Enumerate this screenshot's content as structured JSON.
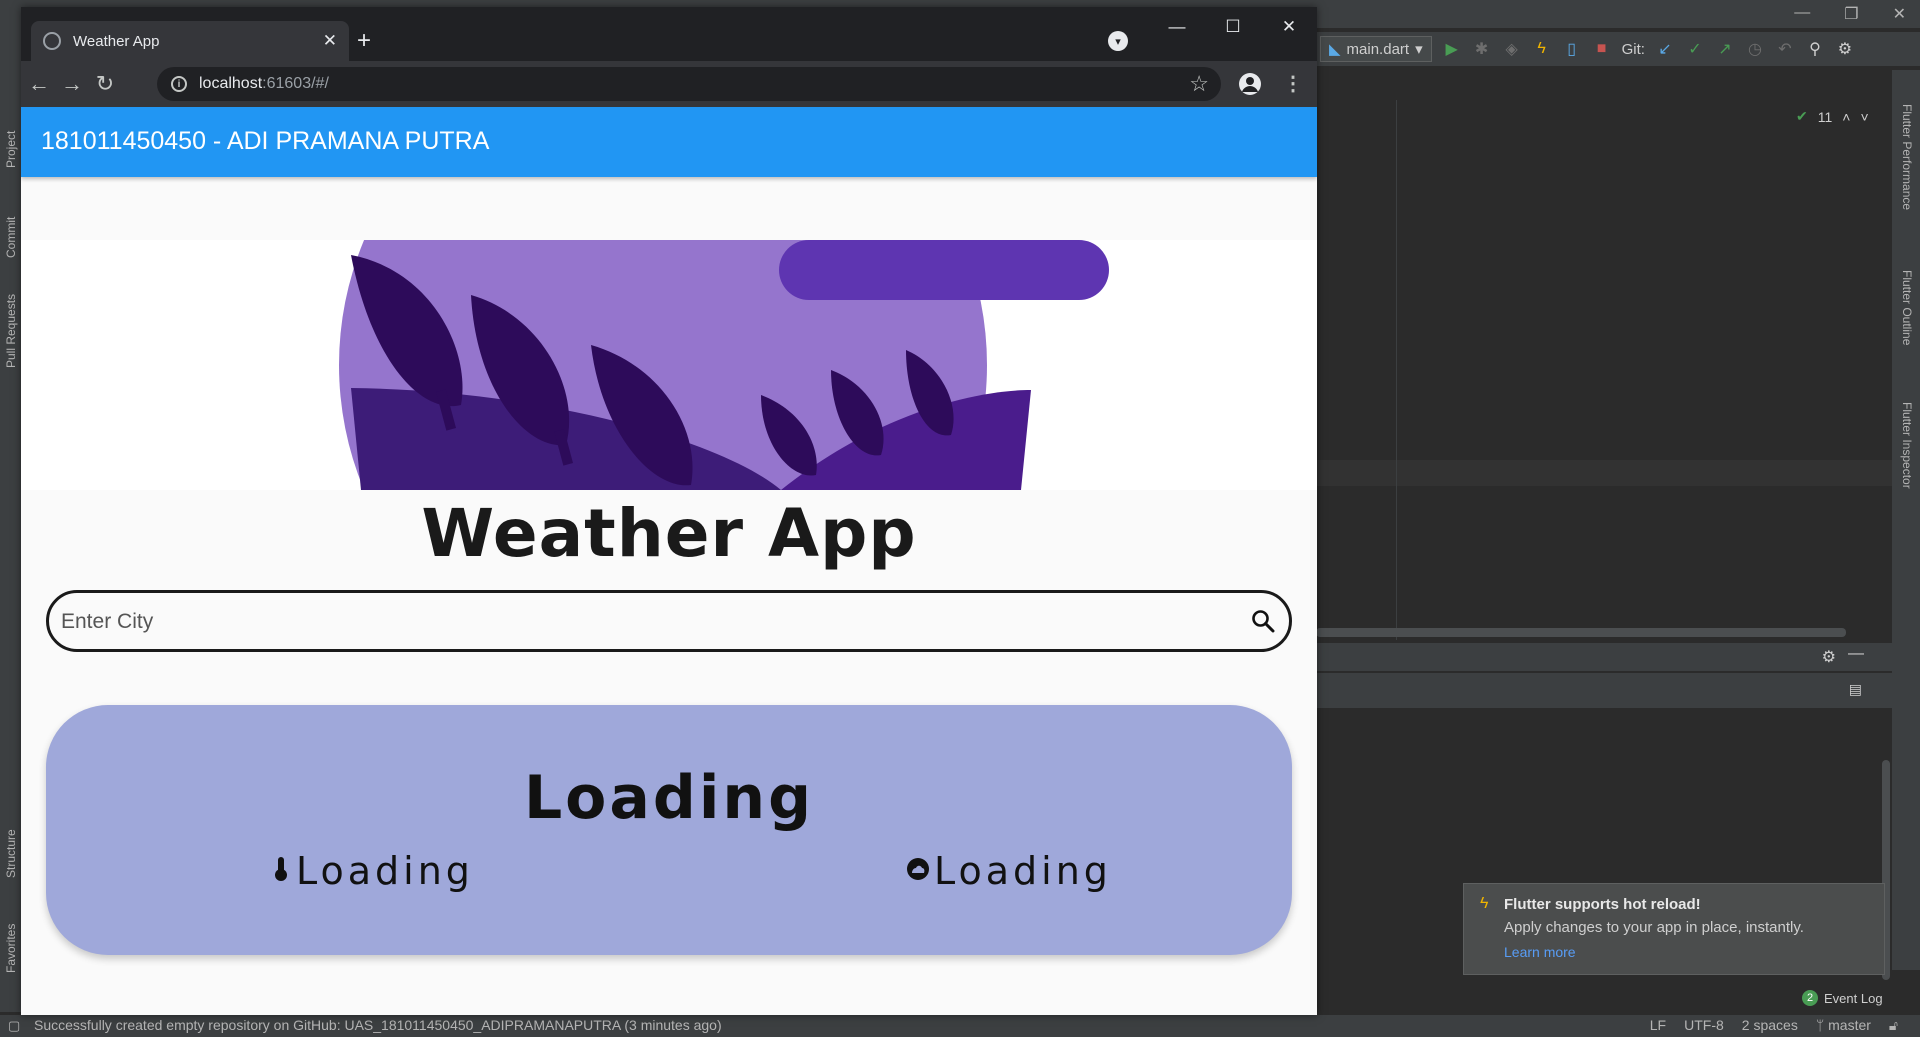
{
  "ide": {
    "run_config": "main.dart",
    "git_label": "Git:",
    "inspection_count": "11",
    "side_left": [
      "Project",
      "Commit",
      "Pull Requests",
      "Structure",
      "Favorites"
    ],
    "side_right": [
      "Flutter Performance",
      "Flutter Outline",
      "Flutter Inspector"
    ],
    "notification": {
      "title": "Flutter supports hot reload!",
      "body": "Apply changes to your app in place, instantly.",
      "link": "Learn more"
    },
    "event_log": {
      "count": "2",
      "label": "Event Log"
    },
    "status": {
      "message": "Successfully created empty repository on GitHub: UAS_181011450450_ADIPRAMANAPUTRA (3 minutes ago)",
      "line_sep": "LF",
      "encoding": "UTF-8",
      "indent": "2 spaces",
      "branch": "master"
    }
  },
  "browser": {
    "tab_title": "Weather App",
    "url_host": "localhost",
    "url_rest": ":61603/#/"
  },
  "app": {
    "appbar_title": "181011450450 - ADI PRAMANA PUTRA",
    "title": "Weather App",
    "search": {
      "placeholder": "Enter City",
      "value": ""
    },
    "card": {
      "city": "Loading",
      "temperature": "Loading",
      "condition": "Loading"
    }
  },
  "colors": {
    "appbar": "#2196f3",
    "card": "#9fa8da",
    "illustration_circle": "#9575cd",
    "illustration_dark": "#2d0b5a"
  }
}
